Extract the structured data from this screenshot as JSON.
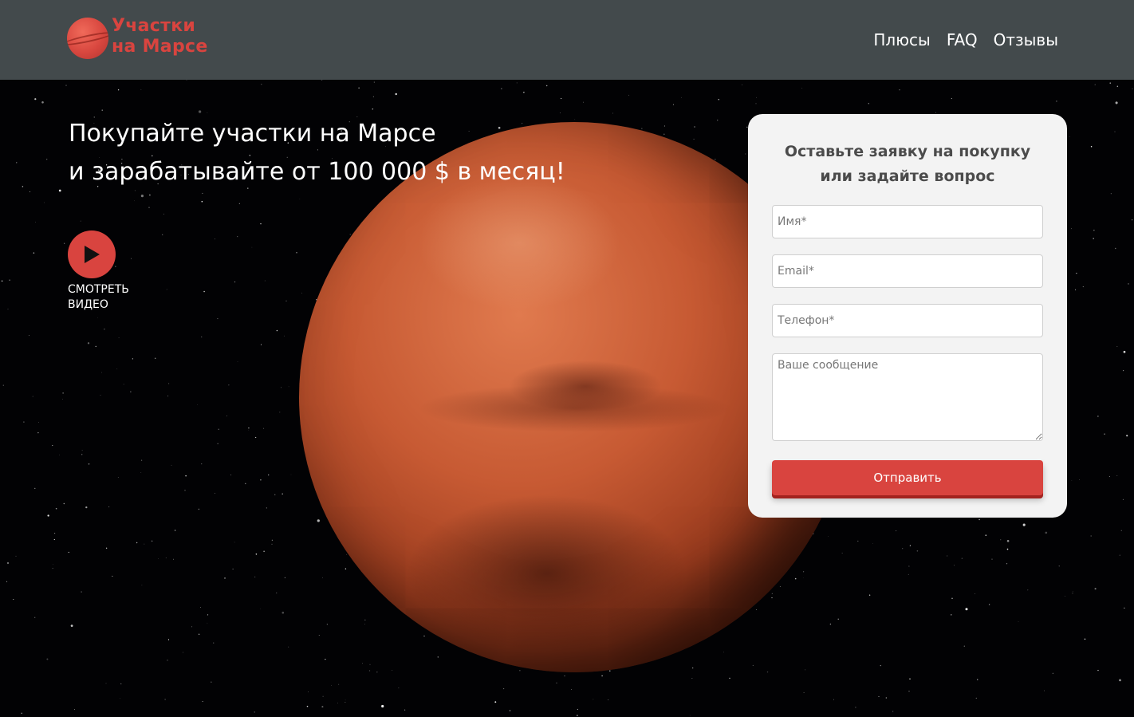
{
  "logo": {
    "line1": "Участки",
    "line2": "на Марсе",
    "icon": "mars-planet-icon"
  },
  "nav": {
    "items": [
      {
        "label": "Плюсы"
      },
      {
        "label": "FAQ"
      },
      {
        "label": "Отзывы"
      }
    ]
  },
  "hero": {
    "headline_line1": "Покупайте участки на Марсе",
    "headline_line2": "и зарабатывайте от 100 000 $ в месяц!",
    "video_label_line1": "Смотреть",
    "video_label_line2": "видео",
    "video_icon": "play-icon"
  },
  "form": {
    "title_line1": "Оставьте заявку на покупку",
    "title_line2": "или задайте вопрос",
    "name_placeholder": "Имя*",
    "email_placeholder": "Email*",
    "phone_placeholder": "Телефон*",
    "message_placeholder": "Ваше сообщение",
    "submit_label": "Отправить"
  },
  "colors": {
    "accent": "#d9443f",
    "header_bg": "#434a4c",
    "form_bg": "#f3f3f3"
  }
}
